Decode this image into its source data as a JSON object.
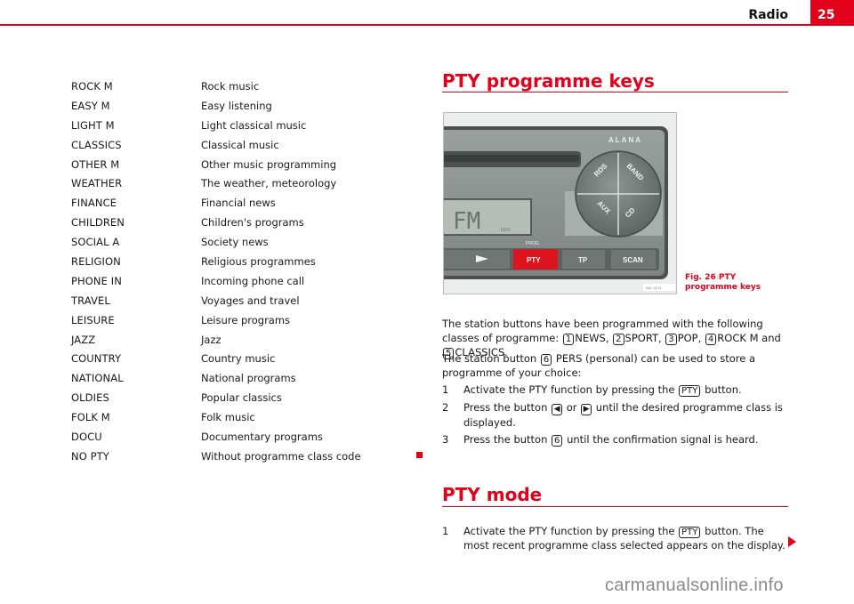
{
  "header": {
    "title": "Radio",
    "page_number": "25"
  },
  "pty_list": [
    {
      "code": "ROCK M",
      "description": "Rock music"
    },
    {
      "code": "EASY M",
      "description": "Easy listening"
    },
    {
      "code": "LIGHT M",
      "description": "Light classical music"
    },
    {
      "code": "CLASSICS",
      "description": "Classical music"
    },
    {
      "code": "OTHER M",
      "description": "Other music programming"
    },
    {
      "code": "WEATHER",
      "description": "The weather, meteorology"
    },
    {
      "code": "FINANCE",
      "description": "Financial news"
    },
    {
      "code": "CHILDREN",
      "description": "Children's programs"
    },
    {
      "code": "SOCIAL A",
      "description": "Society news"
    },
    {
      "code": "RELIGION",
      "description": "Religious programmes"
    },
    {
      "code": "PHONE IN",
      "description": "Incoming phone call"
    },
    {
      "code": "TRAVEL",
      "description": "Voyages and travel"
    },
    {
      "code": "LEISURE",
      "description": "Leisure programs"
    },
    {
      "code": "JAZZ",
      "description": "Jazz"
    },
    {
      "code": "COUNTRY",
      "description": "Country music"
    },
    {
      "code": "NATIONAL",
      "description": "National programs"
    },
    {
      "code": "OLDIES",
      "description": "Popular classics"
    },
    {
      "code": "FOLK M",
      "description": "Folk music"
    },
    {
      "code": "DOCU",
      "description": "Documentary programs"
    },
    {
      "code": "NO PTY",
      "description": "Without programme class code"
    }
  ],
  "section1": {
    "title": "PTY programme keys",
    "figure": {
      "brand": "ALANA",
      "display_text": "FM",
      "display_small": "RDS",
      "round_buttons": [
        "RDS",
        "BAND",
        "AUX",
        "CD"
      ],
      "prog_label": "PROG",
      "buttons": [
        "PTY",
        "TP",
        "SCAN"
      ],
      "ref_code": "B6L-0144",
      "caption": "Fig. 26   PTY programme keys"
    },
    "para1": {
      "prefix": "The station buttons have been programmed with the following classes of programme:",
      "items": [
        {
          "key": "1",
          "label": "NEWS,"
        },
        {
          "key": "2",
          "label": "SPORT,"
        },
        {
          "key": "3",
          "label": "POP,"
        },
        {
          "key": "4",
          "label": "ROCK M and"
        },
        {
          "key": "5",
          "label": "CLASSICS."
        }
      ]
    },
    "para2": {
      "prefix": "The station button",
      "key": "6",
      "suffix": "PERS (personal) can be used to store a programme of your choice:"
    },
    "steps": [
      {
        "num": "1",
        "before": "Activate the PTY function by pressing the",
        "key": "PTY",
        "after": "button."
      },
      {
        "num": "2",
        "before": "Press the button",
        "key_left": "◀",
        "mid": "or",
        "key_right": "▶",
        "after": "until the desired programme class is displayed."
      },
      {
        "num": "3",
        "before": "Press the button",
        "key": "6",
        "after": "until the confirmation signal is heard."
      }
    ]
  },
  "section2": {
    "title": "PTY mode",
    "steps": [
      {
        "num": "1",
        "before": "Activate the PTY function by pressing the",
        "key": "PTY",
        "after": "button. The most recent programme class selected appears on the display."
      }
    ]
  },
  "watermark": "carmanualsonline.info",
  "colors": {
    "accent": "#e3001b",
    "text": "#1a1a1a",
    "watermark": "#8a8a8a"
  }
}
